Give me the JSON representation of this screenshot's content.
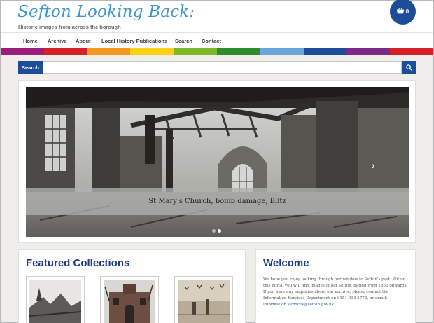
{
  "header": {
    "site_title": "Sefton Looking Back:",
    "tagline": "Historic images from across the borough",
    "cart_count": "0",
    "cart_icon": "basket-icon"
  },
  "nav": {
    "items": [
      "Home",
      "Archive",
      "About",
      "Local History Publications",
      "Search",
      "Contact"
    ]
  },
  "rainbow_colors": [
    "#9a1f7d",
    "#d52027",
    "#f29a1f",
    "#fcd116",
    "#7cb828",
    "#2e8b2f",
    "#6aa5dc",
    "#1d4d98",
    "#7b2a85",
    "#d52027"
  ],
  "search": {
    "label": "Search",
    "value": "",
    "button_icon": "search-icon"
  },
  "slider": {
    "caption": "St Mary's Church, bomb damage, Blitz",
    "next_icon": "chevron-right-icon",
    "slide_count": 2,
    "active_index": 1
  },
  "featured": {
    "title": "Featured Collections"
  },
  "welcome": {
    "title": "Welcome",
    "body": "We hope you enjoy looking through our window to Sefton's past.  Within this portal you will find images of old Sefton, dating from 1850 onwards.  If you have any enquiries about our archive, please contact the Information Services Department on 0151 934 5773, or email: ",
    "email": "information.services@sefton.gov.uk"
  },
  "colors": {
    "brand_blue": "#1d4d98",
    "title_blue": "#3f95cf",
    "heading_blue": "#1d3c86"
  }
}
